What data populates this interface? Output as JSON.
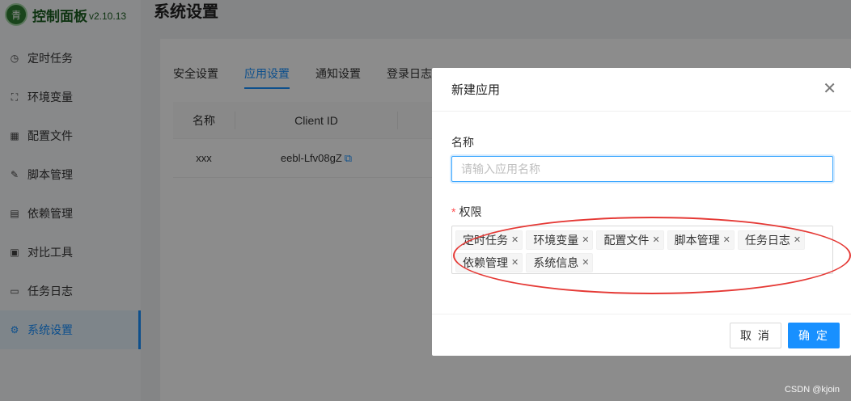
{
  "app": {
    "logo_mark": "青",
    "title": "控制面板",
    "version": "v2.10.13"
  },
  "sidebar": {
    "items": [
      {
        "icon": "clock-icon",
        "glyph": "◷",
        "label": "定时任务"
      },
      {
        "icon": "env-icon",
        "glyph": "⛶",
        "label": "环境变量"
      },
      {
        "icon": "config-icon",
        "glyph": "▦",
        "label": "配置文件"
      },
      {
        "icon": "edit-icon",
        "glyph": "✎",
        "label": "脚本管理"
      },
      {
        "icon": "package-icon",
        "glyph": "▤",
        "label": "依赖管理"
      },
      {
        "icon": "diff-icon",
        "glyph": "▣",
        "label": "对比工具"
      },
      {
        "icon": "folder-icon",
        "glyph": "▭",
        "label": "任务日志"
      },
      {
        "icon": "gear-icon",
        "glyph": "⚙",
        "label": "系统设置",
        "active": true
      }
    ]
  },
  "page": {
    "title": "系统设置",
    "tabs": [
      "安全设置",
      "应用设置",
      "通知设置",
      "登录日志"
    ],
    "active_tab": "应用设置",
    "table": {
      "headers": [
        "名称",
        "Client ID"
      ],
      "rows": [
        {
          "name": "xxx",
          "client_id": "eebl-Lfv08gZ"
        }
      ]
    }
  },
  "modal": {
    "title": "新建应用",
    "name_label": "名称",
    "name_placeholder": "请输入应用名称",
    "name_value": "",
    "scope_label": "权限",
    "scopes": [
      "定时任务",
      "环境变量",
      "配置文件",
      "脚本管理",
      "任务日志",
      "依赖管理",
      "系统信息"
    ],
    "cancel_label": "取 消",
    "ok_label": "确 定"
  },
  "watermark": "CSDN @kjoin",
  "colors": {
    "primary": "#1890ff",
    "annotation": "#e53935"
  }
}
